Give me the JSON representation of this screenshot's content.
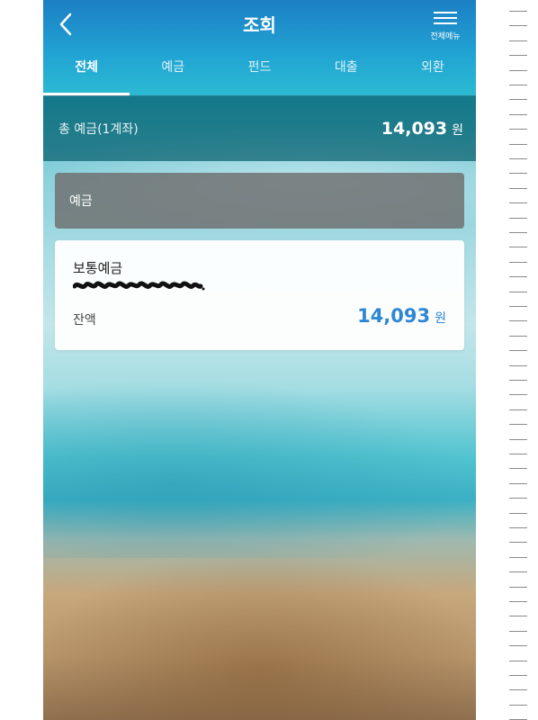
{
  "header": {
    "title": "조회",
    "menu_label": "전체메뉴"
  },
  "tabs": [
    {
      "label": "전체",
      "active": true
    },
    {
      "label": "예금",
      "active": false
    },
    {
      "label": "펀드",
      "active": false
    },
    {
      "label": "대출",
      "active": false
    },
    {
      "label": "외환",
      "active": false
    }
  ],
  "summary": {
    "label": "총 예금(1계좌)",
    "amount": "14,093",
    "unit": "원"
  },
  "section": {
    "title": "예금"
  },
  "account": {
    "name": "보통예금",
    "number_redacted": true,
    "balance_label": "잔액",
    "balance": "14,093",
    "unit": "원"
  },
  "colors": {
    "accent_yellow": "#f4c20d",
    "balance_blue": "#2f86d3",
    "header_blue": "#1c7fc4"
  },
  "icons": {
    "back": "chevron-left-icon",
    "menu": "hamburger-menu-icon",
    "side_tab": "chevron-left-icon"
  }
}
